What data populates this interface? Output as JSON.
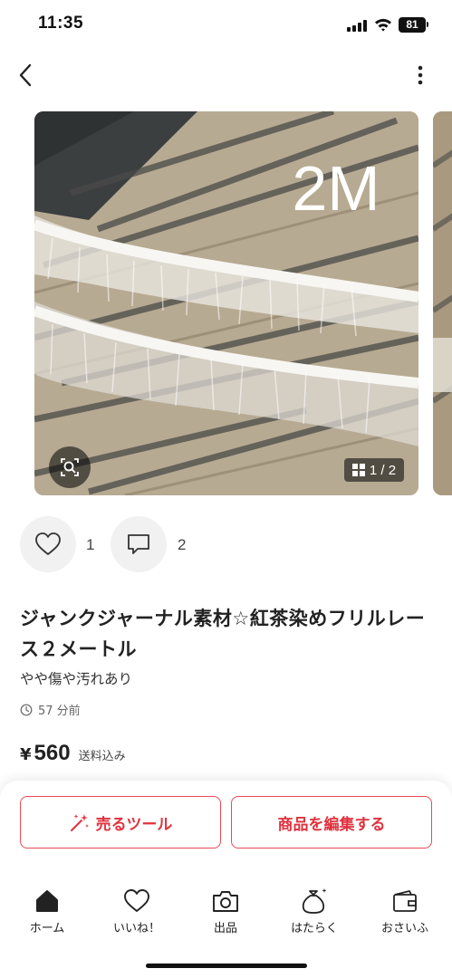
{
  "status_bar": {
    "time": "11:35",
    "battery": "81"
  },
  "listing": {
    "photo_label": "2M",
    "photo_counter": "1 / 2",
    "likes": "1",
    "comments": "2",
    "title": "ジャンクジャーナル素材☆紅茶染めフリルレース２メートル",
    "condition": "やや傷や汚れあり",
    "posted": "57 分前",
    "price_symbol": "¥",
    "price": "560",
    "shipping_note": "送料込み"
  },
  "actions": {
    "sell_tool": "売るツール",
    "edit": "商品を編集する"
  },
  "tabs": [
    {
      "label": "ホーム",
      "icon": "home-icon"
    },
    {
      "label": "いいね！",
      "icon": "heart-icon"
    },
    {
      "label": "出品",
      "icon": "camera-icon"
    },
    {
      "label": "はたらく",
      "icon": "money-bag-icon"
    },
    {
      "label": "おさいふ",
      "icon": "wallet-icon"
    }
  ],
  "colors": {
    "accent": "#e0323e",
    "text": "#222222"
  }
}
